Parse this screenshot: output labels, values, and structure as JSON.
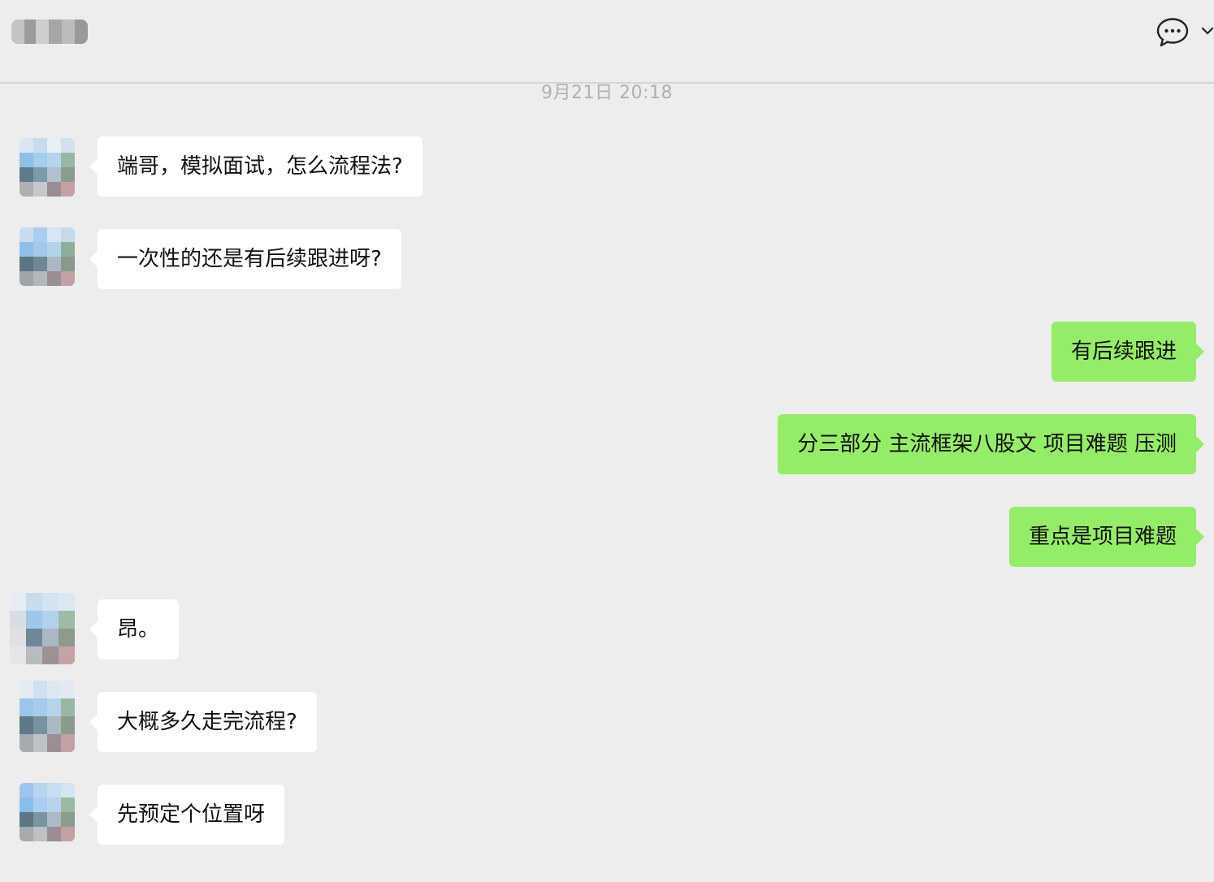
{
  "header": {
    "timestamp": "9月21日 20:18",
    "icons": {
      "chat": "chat-bubble-icon",
      "chevron": "chevron-down-icon"
    }
  },
  "colors": {
    "background": "#ededed",
    "incoming_bubble": "#ffffff",
    "outgoing_bubble": "#95ec69"
  },
  "messages": [
    {
      "side": "in",
      "text": "端哥，模拟面试，怎么流程法?"
    },
    {
      "side": "in",
      "text": "一次性的还是有后续跟进呀?"
    },
    {
      "side": "out",
      "text": "有后续跟进"
    },
    {
      "side": "out",
      "text": "分三部分 主流框架八股文 项目难题 压测"
    },
    {
      "side": "out",
      "text": "重点是项目难题"
    },
    {
      "side": "in",
      "text": "昂。"
    },
    {
      "side": "in",
      "text": "大概多久走完流程?"
    },
    {
      "side": "in",
      "text": "先预定个位置呀"
    }
  ]
}
